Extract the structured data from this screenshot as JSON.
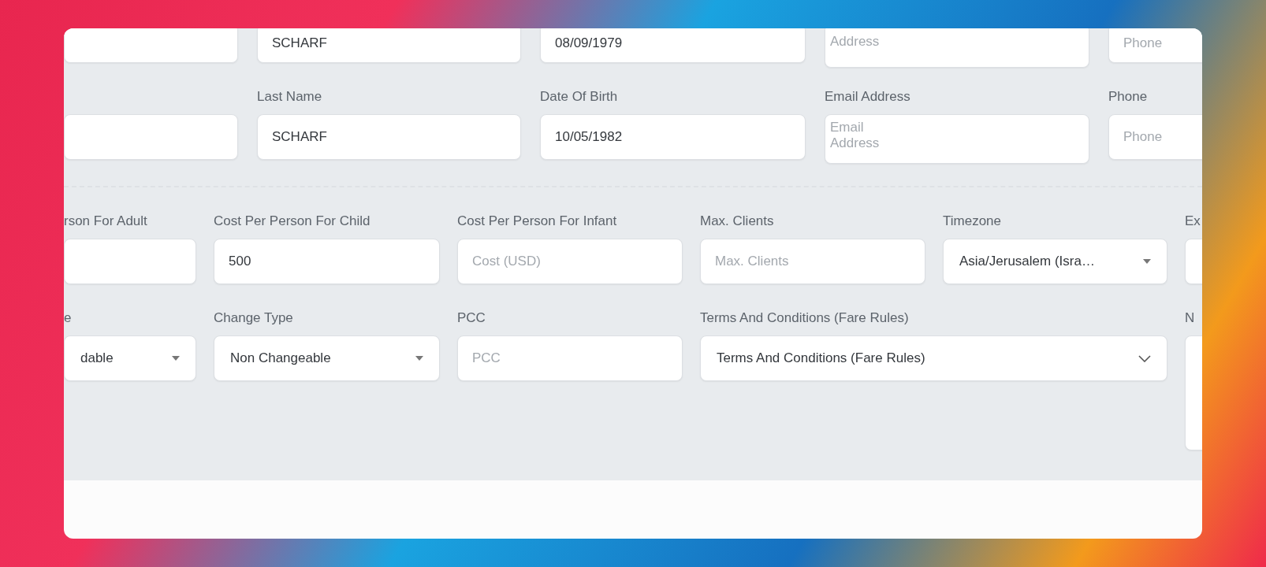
{
  "passenger_rows": [
    {
      "fields": [
        {
          "kind": "text"
        },
        {
          "kind": "text",
          "value": "SCHARF"
        },
        {
          "kind": "text",
          "value": "08/09/1979"
        },
        {
          "kind": "textarea",
          "placeholder": "Address"
        },
        {
          "kind": "text",
          "placeholder": "Phone"
        }
      ]
    },
    {
      "fields": [
        {
          "kind": "text"
        },
        {
          "kind": "text",
          "label": "Last Name",
          "value": "SCHARF"
        },
        {
          "kind": "text",
          "label": "Date Of Birth",
          "value": "10/05/1982"
        },
        {
          "kind": "textarea",
          "label": "Email Address",
          "placeholder": "Email\nAddress"
        },
        {
          "kind": "text",
          "label": "Phone",
          "placeholder": "Phone"
        }
      ]
    }
  ],
  "trip_rows": [
    {
      "fields": [
        {
          "kind": "text",
          "label": "rson For Adult"
        },
        {
          "kind": "text",
          "label": "Cost Per Person For Child",
          "value": "500"
        },
        {
          "kind": "text",
          "label": "Cost Per Person For Infant",
          "placeholder": "Cost (USD)"
        },
        {
          "kind": "text",
          "label": "Max. Clients",
          "placeholder": "Max. Clients"
        },
        {
          "kind": "select",
          "label": "Timezone",
          "value": "Asia/Jerusalem (Isra…"
        },
        {
          "kind": "text",
          "label": "Ex"
        }
      ]
    },
    {
      "fields": [
        {
          "kind": "select",
          "label": "e",
          "value": "dable"
        },
        {
          "kind": "select",
          "label": "Change Type",
          "value": "Non Changeable"
        },
        {
          "kind": "text",
          "label": "PCC",
          "placeholder": "PCC"
        },
        {
          "kind": "chevron-select",
          "label": "Terms And Conditions (Fare Rules)",
          "value": "Terms And Conditions (Fare Rules)",
          "wide": true
        },
        {
          "kind": "textarea",
          "label": "N"
        }
      ]
    }
  ]
}
